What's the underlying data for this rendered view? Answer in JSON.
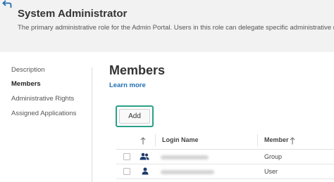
{
  "header": {
    "title": "System Administrator",
    "subtitle": "The primary administrative role for the Admin Portal. Users in this role can delegate specific administrative rights to"
  },
  "nav": {
    "items": [
      {
        "label": "Description",
        "active": false
      },
      {
        "label": "Members",
        "active": true
      },
      {
        "label": "Administrative Rights",
        "active": false
      },
      {
        "label": "Assigned Applications",
        "active": false
      }
    ]
  },
  "main": {
    "title": "Members",
    "learn_more": "Learn more",
    "add_label": "Add"
  },
  "table": {
    "columns": [
      "Login Name",
      "Member"
    ],
    "rows": [
      {
        "member": "Group",
        "icon": "group-icon"
      },
      {
        "member": "User",
        "icon": "user-icon"
      }
    ]
  },
  "colors": {
    "accent": "#2aa08a",
    "link": "#1f6fb2",
    "icon": "#1b3a6b",
    "header_bg": "#f2f2f2"
  }
}
